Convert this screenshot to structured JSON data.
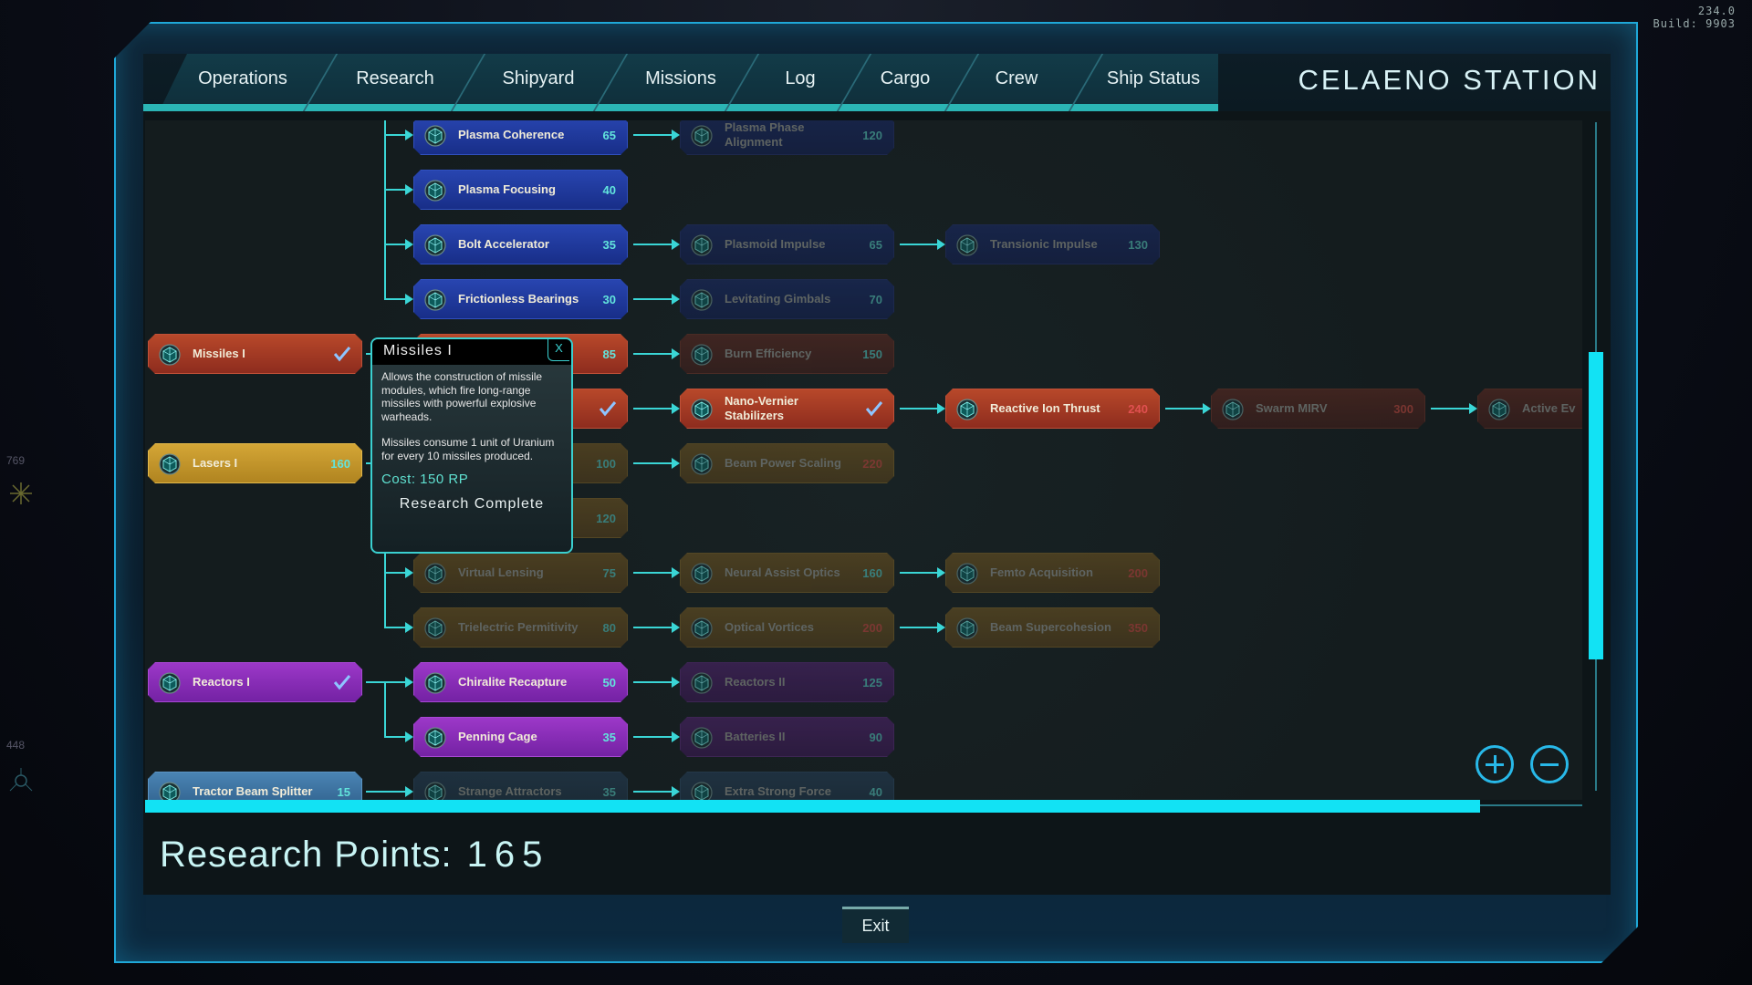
{
  "hud": {
    "version": "234.0",
    "build": "Build: 9903",
    "side_top": "769",
    "side_bottom": "448"
  },
  "tabs": [
    "Operations",
    "Research",
    "Shipyard",
    "Missions",
    "Log",
    "Cargo",
    "Crew",
    "Ship Status"
  ],
  "active_tab": "Research",
  "station_title": "CELAENO STATION",
  "colors": {
    "accent": "#12e2f4",
    "cost_ok": "#62e4dc",
    "cost_too_high": "#e05050",
    "blue": "#2845b0",
    "red": "#b8482a",
    "gold": "#d4a636",
    "purple": "#9c38c8",
    "steel": "#4a84b4"
  },
  "tree": {
    "branches": [
      {
        "theme": "blue",
        "root": null,
        "chains": [
          [
            {
              "name": "Plasma Coherence",
              "cost": 65,
              "state": "available"
            },
            {
              "name": "Plasma Phase Alignment",
              "cost": 120,
              "state": "locked"
            }
          ],
          [
            {
              "name": "Plasma Focusing",
              "cost": 40,
              "state": "available"
            }
          ],
          [
            {
              "name": "Bolt Accelerator",
              "cost": 35,
              "state": "available"
            },
            {
              "name": "Plasmoid Impulse",
              "cost": 65,
              "state": "locked"
            },
            {
              "name": "Transionic Impulse",
              "cost": 130,
              "state": "locked"
            }
          ],
          [
            {
              "name": "Frictionless Bearings",
              "cost": 30,
              "state": "available"
            },
            {
              "name": "Levitating Gimbals",
              "cost": 70,
              "state": "locked"
            }
          ]
        ]
      },
      {
        "theme": "red",
        "root": {
          "name": "Missiles I",
          "cost": 150,
          "state": "complete"
        },
        "chains": [
          [
            {
              "name": "",
              "cost": 85,
              "state": "available"
            },
            {
              "name": "Burn Efficiency",
              "cost": 150,
              "state": "locked"
            }
          ],
          [
            {
              "name": "",
              "cost": null,
              "state": "complete"
            },
            {
              "name": "Nano-Vernier Stabilizers",
              "cost": null,
              "state": "complete"
            },
            {
              "name": "Reactive Ion Thrust",
              "cost": 240,
              "state": "available"
            },
            {
              "name": "Swarm MIRV",
              "cost": 300,
              "state": "locked"
            },
            {
              "name": "Active Ev",
              "cost": null,
              "state": "locked"
            }
          ]
        ]
      },
      {
        "theme": "gold",
        "root": {
          "name": "Lasers I",
          "cost": 160,
          "state": "available"
        },
        "chains": [
          [
            {
              "name": "",
              "cost": 100,
              "state": "locked"
            },
            {
              "name": "Beam Power Scaling",
              "cost": 220,
              "state": "locked"
            }
          ],
          [
            {
              "name": "",
              "cost": 120,
              "state": "locked"
            }
          ],
          [
            {
              "name": "Virtual Lensing",
              "cost": 75,
              "state": "locked"
            },
            {
              "name": "Neural Assist Optics",
              "cost": 160,
              "state": "locked"
            },
            {
              "name": "Femto Acquisition",
              "cost": 200,
              "state": "locked"
            }
          ],
          [
            {
              "name": "Trielectric Permitivity",
              "cost": 80,
              "state": "locked"
            },
            {
              "name": "Optical Vortices",
              "cost": 200,
              "state": "locked"
            },
            {
              "name": "Beam Supercohesion",
              "cost": 350,
              "state": "locked"
            }
          ]
        ]
      },
      {
        "theme": "purple",
        "root": {
          "name": "Reactors I",
          "cost": null,
          "state": "complete"
        },
        "chains": [
          [
            {
              "name": "Chiralite Recapture",
              "cost": 50,
              "state": "available"
            },
            {
              "name": "Reactors II",
              "cost": 125,
              "state": "locked"
            }
          ],
          [
            {
              "name": "Penning Cage",
              "cost": 35,
              "state": "available"
            },
            {
              "name": "Batteries II",
              "cost": 90,
              "state": "locked"
            }
          ]
        ]
      },
      {
        "theme": "steel",
        "root": {
          "name": "Tractor Beam Splitter",
          "cost": 15,
          "state": "available"
        },
        "chains": [
          [
            {
              "name": "Strange Attractors",
              "cost": 35,
              "state": "locked"
            },
            {
              "name": "Extra Strong Force",
              "cost": 40,
              "state": "locked"
            }
          ]
        ]
      }
    ]
  },
  "tooltip": {
    "title": "Missiles I",
    "close": "X",
    "desc1": "Allows the construction of missile modules, which fire long-range missiles with powerful explosive warheads.",
    "desc2": "Missiles consume 1 unit of Uranium for every 10 missiles produced.",
    "cost": "Cost: 150 RP",
    "status": "Research Complete"
  },
  "research_points": {
    "label": "Research Points:",
    "value": 165
  },
  "exit_label": "Exit"
}
